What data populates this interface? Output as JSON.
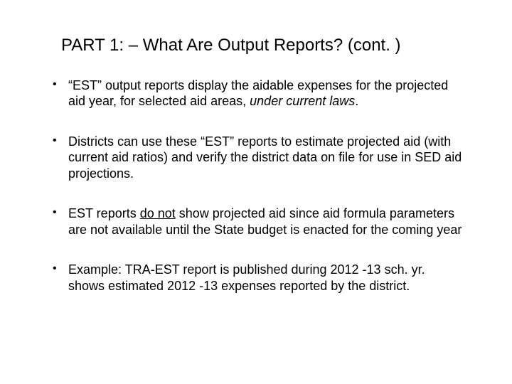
{
  "title": "PART 1: – What Are Output Reports? (cont. )",
  "bullets": [
    {
      "pre": "“EST” output reports display the aidable expenses for the projected aid year, for selected aid areas, ",
      "em": "under current laws",
      "post": "."
    },
    {
      "pre": "Districts can use these “EST” reports to estimate projected aid (with current aid ratios) and verify the district data on file for use in SED aid projections.",
      "em": "",
      "post": ""
    },
    {
      "pre": "EST reports ",
      "u": "do not",
      "post": " show projected aid since aid formula parameters are not available until the State budget is enacted for the coming year"
    },
    {
      "pre": "Example:  TRA-EST report is published during 2012 -13 sch. yr. shows estimated 2012 -13 expenses reported by the district.",
      "em": "",
      "post": ""
    }
  ]
}
